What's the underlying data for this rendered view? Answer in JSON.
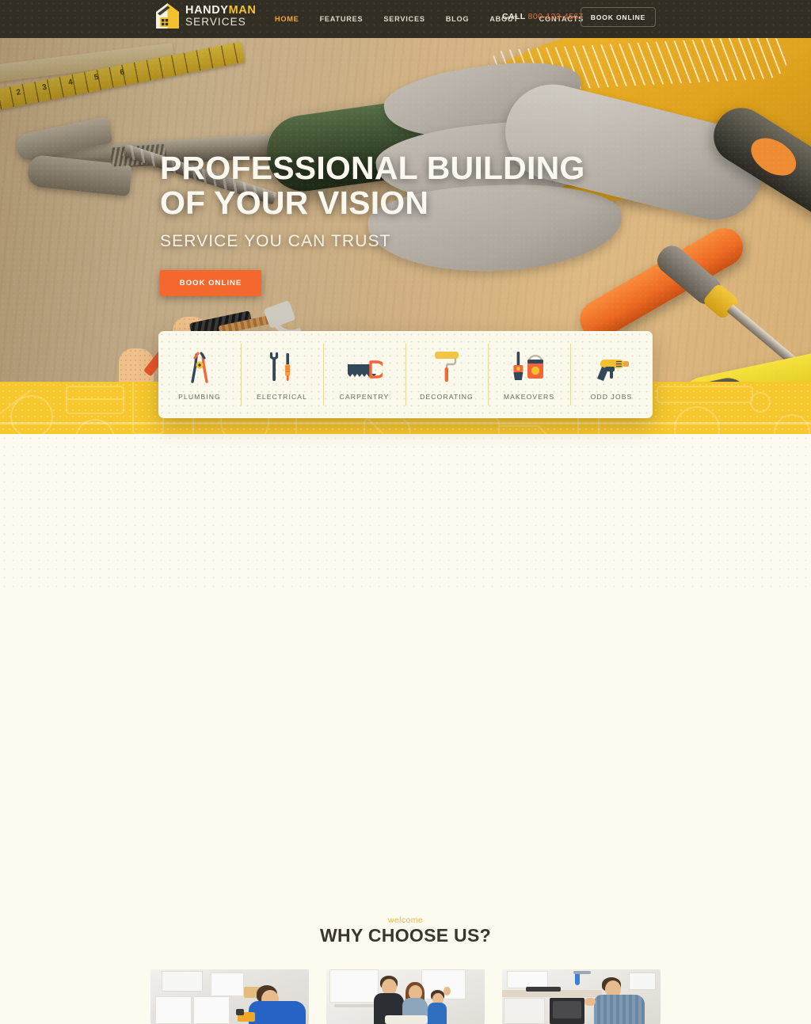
{
  "site": {
    "brand_line1_a": "HANDY",
    "brand_line1_b": "MAN",
    "brand_line2": "SERVICES"
  },
  "header": {
    "nav": [
      {
        "label": "HOME",
        "active": true
      },
      {
        "label": "FEATURES",
        "active": false
      },
      {
        "label": "SERVICES",
        "active": false
      },
      {
        "label": "BLOG",
        "active": false
      },
      {
        "label": "ABOUT",
        "active": false
      },
      {
        "label": "CONTACTS",
        "active": false
      }
    ],
    "call_label": "CALL",
    "phone": "800-123-4567",
    "book_button": "BOOK ONLINE",
    "bg_color": "#332e24",
    "accent_color": "#f2a72e",
    "phone_color": "#e8703a"
  },
  "hero": {
    "heading_line1": "PROFESSIONAL BUILDING",
    "heading_line2": "OF YOUR VISION",
    "subheading": "SERVICE YOU CAN TRUST",
    "cta_label": "BOOK ONLINE",
    "cta_color": "#f4682e"
  },
  "services": {
    "items": [
      {
        "label": "PLUMBING",
        "icon": "pliers-icon"
      },
      {
        "label": "ELECTRICAL",
        "icon": "wrench-screwdriver-icon"
      },
      {
        "label": "CARPENTRY",
        "icon": "handsaw-icon"
      },
      {
        "label": "DECORATING",
        "icon": "paint-roller-icon"
      },
      {
        "label": "MAKEOVERS",
        "icon": "brush-paintcan-icon"
      },
      {
        "label": "ODD JOBS",
        "icon": "drill-icon"
      }
    ],
    "card_bg": "#fbf8ec",
    "divider_color": "#e9d79a"
  },
  "band": {
    "color": "#f7c82e"
  },
  "why": {
    "eyebrow": "welcome",
    "title": "WHY CHOOSE US?",
    "eyebrow_color": "#edb84a",
    "bg_color": "#fdfaef",
    "cards": [
      {
        "alt": "handyman-drilling-under-kitchen-cabinet"
      },
      {
        "alt": "family-in-kitchen"
      },
      {
        "alt": "handyman-installing-oven"
      }
    ]
  }
}
